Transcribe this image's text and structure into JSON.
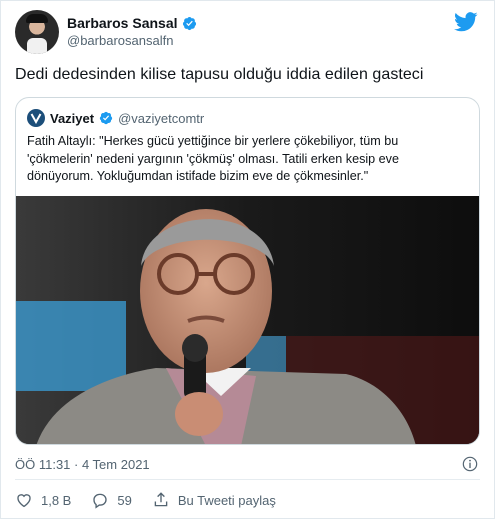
{
  "author": {
    "name": "Barbaros Sansal",
    "handle": "@barbarosansalfn",
    "verified": true
  },
  "tweet_text": "Dedi dedesinden kilise tapusu olduğu iddia edilen  gasteci",
  "quoted": {
    "name": "Vaziyet",
    "handle": "@vaziyetcomtr",
    "text": "Fatih Altaylı: \"Herkes gücü yettiğince bir yerlere çökebiliyor, tüm bu 'çökmelerin' nedeni yargının 'çökmüş' olması. Tatili erken kesip eve dönüyorum. Yokluğumdan istifade bizim eve de çökmesinler.\""
  },
  "meta": {
    "timestamp": "ÖÖ 11:31 · 4 Tem 2021"
  },
  "actions": {
    "likes": "1,8 B",
    "replies": "59",
    "share_label": "Bu Tweeti paylaş"
  },
  "colors": {
    "accent": "#1d9bf0",
    "muted": "#536471",
    "like_red": "#e0245e"
  },
  "icons": [
    "verified-badge-icon",
    "twitter-bird-icon",
    "info-icon",
    "heart-icon",
    "reply-icon",
    "share-icon"
  ]
}
